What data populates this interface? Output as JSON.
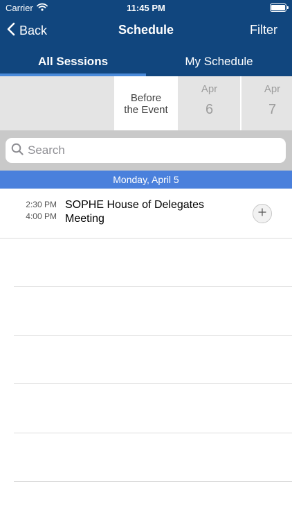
{
  "status_bar": {
    "carrier": "Carrier",
    "time": "11:45 PM"
  },
  "nav": {
    "back_label": "Back",
    "title": "Schedule",
    "filter_label": "Filter"
  },
  "tabs": [
    {
      "label": "All Sessions",
      "active": true
    },
    {
      "label": "My Schedule",
      "active": false
    }
  ],
  "date_strip": {
    "before_line1": "Before",
    "before_line2": "the Event",
    "days": [
      {
        "month": "Apr",
        "day": "6"
      },
      {
        "month": "Apr",
        "day": "7"
      }
    ]
  },
  "search": {
    "placeholder": "Search"
  },
  "day_header": "Monday, April 5",
  "sessions": [
    {
      "start": "2:30 PM",
      "end": "4:00 PM",
      "title": "SOPHE House of Delegates Meeting"
    }
  ],
  "colors": {
    "header_bg": "#11467e",
    "tab_indicator": "#4a8ad9",
    "day_header_bg": "#4a80dc"
  }
}
